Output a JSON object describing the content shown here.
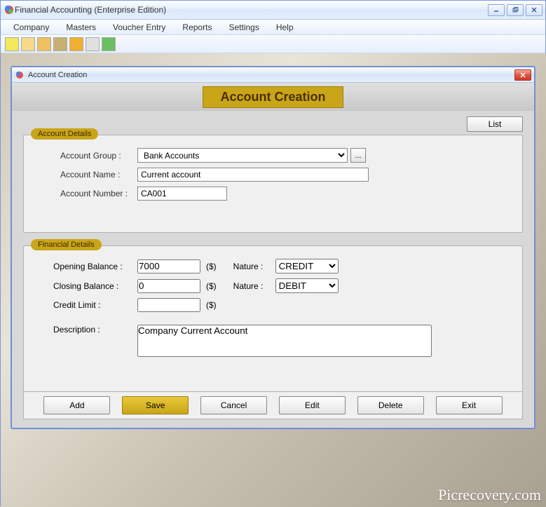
{
  "app": {
    "title": "Financial Accounting (Enterprise Edition)"
  },
  "menu": {
    "items": [
      "Company",
      "Masters",
      "Voucher Entry",
      "Reports",
      "Settings",
      "Help"
    ]
  },
  "dialog": {
    "title": "Account Creation",
    "banner": "Account Creation",
    "list_label": "List",
    "section1_legend": "Account Details",
    "section2_legend": "Financial Details",
    "labels": {
      "account_group": "Account Group  :",
      "account_name": "Account Name  :",
      "account_number": "Account Number  :",
      "opening_balance": "Opening Balance  :",
      "closing_balance": "Closing Balance  :",
      "credit_limit": "Credit Limit  :",
      "nature": "Nature :",
      "description": "Description  :",
      "currency": "($)"
    },
    "values": {
      "account_group": "Bank Accounts",
      "account_name": "Current account",
      "account_number": "CA001",
      "opening_balance": "7000",
      "closing_balance": "0",
      "credit_limit": "",
      "nature1": "CREDIT",
      "nature2": "DEBIT",
      "description": "Company Current Account"
    },
    "ellipsis": "...",
    "buttons": {
      "add": "Add",
      "save": "Save",
      "cancel": "Cancel",
      "edit": "Edit",
      "delete": "Delete",
      "exit": "Exit"
    }
  },
  "watermark": "Picrecovery.com"
}
